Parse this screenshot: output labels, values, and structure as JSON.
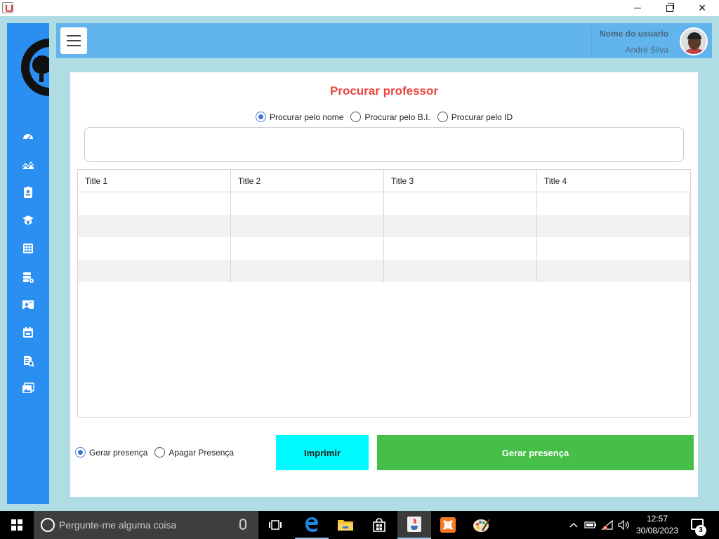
{
  "window": {
    "minimize": "",
    "maximize": "",
    "close": "✕"
  },
  "sidebar": {
    "icons": [
      "dashboard-icon",
      "chart-icon",
      "id-badge-icon",
      "graduation-cap-icon",
      "calculator-icon",
      "database-settings-icon",
      "classroom-icon",
      "calendar-icon",
      "report-search-icon",
      "gallery-icon"
    ]
  },
  "header": {
    "user_label": "Nome do usuario",
    "user_name": "André Silva"
  },
  "main": {
    "title": "Procurar professor",
    "search_options": [
      {
        "label": "Procurar pelo nome",
        "checked": true
      },
      {
        "label": "Procurar pelo B.I.",
        "checked": false
      },
      {
        "label": "Procurar pelo ID",
        "checked": false
      }
    ],
    "search_value": "",
    "table": {
      "columns": [
        "Title 1",
        "Title 2",
        "Title 3",
        "Title 4"
      ],
      "rows": [
        [
          "",
          "",
          "",
          ""
        ],
        [
          "",
          "",
          "",
          ""
        ],
        [
          "",
          "",
          "",
          ""
        ],
        [
          "",
          "",
          "",
          ""
        ]
      ]
    },
    "presence_options": [
      {
        "label": "Gerar presença",
        "checked": true
      },
      {
        "label": "Apagar Presença",
        "checked": false
      }
    ],
    "print_button": "Imprimir",
    "generate_button": "Gerar presença"
  },
  "taskbar": {
    "search_placeholder": "Pergunte-me alguma coisa",
    "time": "12:57",
    "date": "30/08/2023",
    "notifications": "3"
  },
  "colors": {
    "sidebar": "#2b8ff2",
    "header": "#62b4ec",
    "title": "#e8443f",
    "print_button": "#00fbff",
    "generate_button": "#45bf48"
  }
}
